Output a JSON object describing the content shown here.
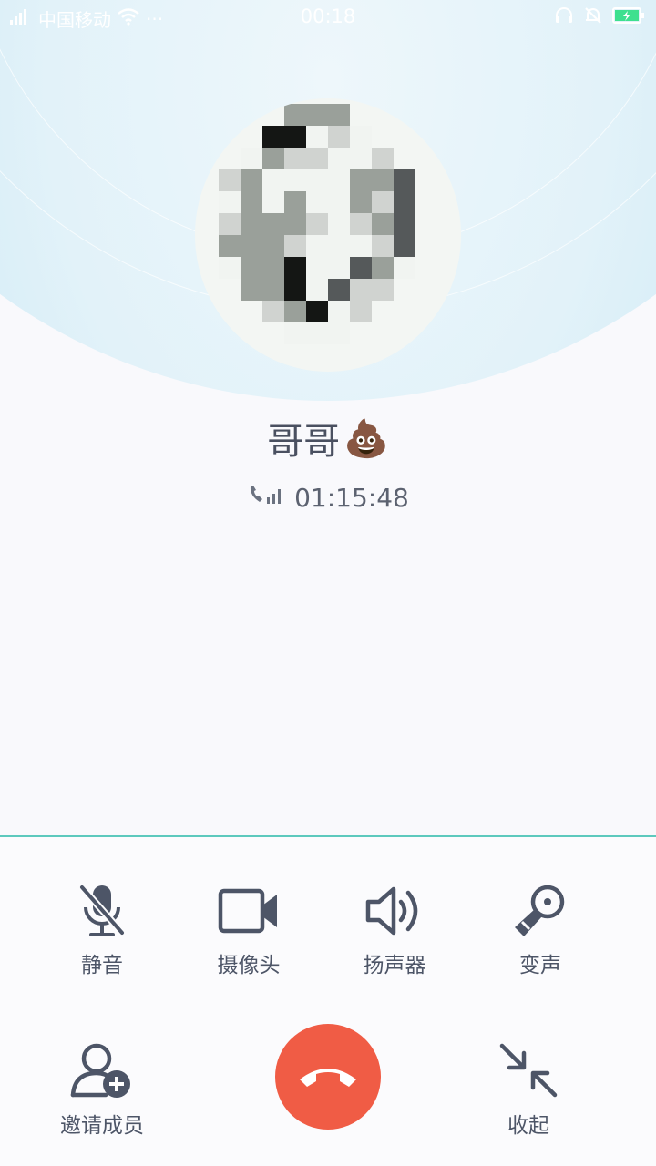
{
  "status_bar": {
    "carrier": "中国移动",
    "more": "···",
    "time": "00:18"
  },
  "call": {
    "contact_name": "哥哥",
    "contact_emoji": "💩",
    "duration": "01:15:48"
  },
  "controls": {
    "mute_label": "静音",
    "camera_label": "摄像头",
    "speaker_label": "扬声器",
    "voice_change_label": "变声",
    "invite_label": "邀请成员",
    "collapse_label": "收起"
  },
  "colors": {
    "accent_line": "#5dc9bd",
    "hangup": "#f05c45",
    "icon": "#4d5567",
    "battery": "#3ee08f"
  },
  "icons": {
    "signal": "signal-icon",
    "wifi": "wifi-icon",
    "headset": "headset-icon",
    "bell_off": "bell-off-icon",
    "battery": "battery-charging-icon",
    "call_signal": "call-signal-icon",
    "mute": "mic-off-icon",
    "camera": "video-camera-icon",
    "speaker": "speaker-icon",
    "voice_change": "microphone-icon",
    "invite": "add-user-icon",
    "hangup": "hangup-icon",
    "collapse": "collapse-icon"
  }
}
